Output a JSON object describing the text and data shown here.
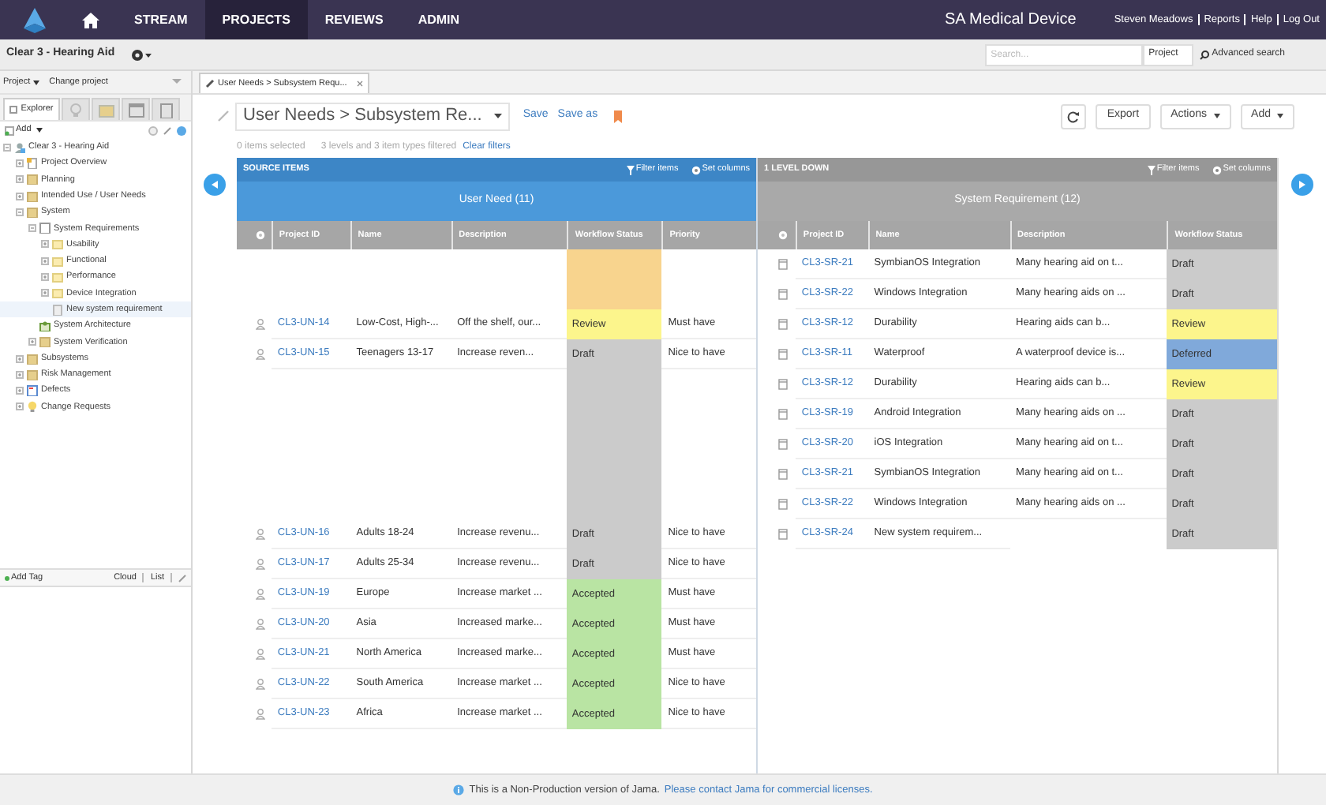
{
  "nav": {
    "items": [
      {
        "label": "STREAM",
        "selected": false
      },
      {
        "label": "PROJECTS",
        "selected": true
      },
      {
        "label": "REVIEWS",
        "selected": false
      },
      {
        "label": "ADMIN",
        "selected": false
      }
    ],
    "org": "SA Medical Device",
    "user_links": [
      "Steven Meadows",
      "Reports",
      "Help",
      "Log Out"
    ]
  },
  "project_bar": {
    "name": "Clear 3 - Hearing Aid",
    "search": {
      "placeholder": "Search..."
    },
    "scope": "Project",
    "advanced": "Advanced search"
  },
  "sidebar": {
    "project_menu": "Project",
    "change": "Change project",
    "tabs": [
      {
        "kind": "explorer",
        "label": "Explorer",
        "selected": true
      },
      {
        "kind": "bulb",
        "selected": false
      },
      {
        "kind": "folder",
        "selected": false
      },
      {
        "kind": "window",
        "selected": false
      },
      {
        "kind": "clipboard",
        "selected": false
      }
    ],
    "add": "Add",
    "tree": [
      {
        "label": "Clear 3 - Hearing Aid",
        "kind": "project",
        "expanded": true,
        "selected": false,
        "children": [
          {
            "label": "Project Overview",
            "kind": "overview",
            "expanded": false,
            "selected": false
          },
          {
            "label": "Planning",
            "kind": "folder",
            "expanded": false,
            "selected": false
          },
          {
            "label": "Intended Use / User Needs",
            "kind": "folder",
            "expanded": false,
            "selected": false
          },
          {
            "label": "System",
            "kind": "folder",
            "expanded": true,
            "selected": false,
            "children": [
              {
                "label": "System Requirements",
                "kind": "set",
                "expanded": true,
                "selected": false,
                "children": [
                  {
                    "label": "Usability",
                    "kind": "subfolder",
                    "expanded": false,
                    "selected": false
                  },
                  {
                    "label": "Functional",
                    "kind": "subfolder",
                    "expanded": false,
                    "selected": false
                  },
                  {
                    "label": "Performance",
                    "kind": "subfolder",
                    "expanded": false,
                    "selected": false
                  },
                  {
                    "label": "Device Integration",
                    "kind": "subfolder",
                    "expanded": false,
                    "selected": false
                  },
                  {
                    "label": "New system requirement",
                    "kind": "item",
                    "selected": true
                  }
                ]
              },
              {
                "label": "System Architecture",
                "kind": "architecture",
                "selected": false
              },
              {
                "label": "System Verification",
                "kind": "folder",
                "expanded": false,
                "selected": false
              }
            ]
          },
          {
            "label": "Subsystems",
            "kind": "folder",
            "expanded": false,
            "selected": false
          },
          {
            "label": "Risk Management",
            "kind": "folder",
            "expanded": false,
            "selected": false
          },
          {
            "label": "Defects",
            "kind": "defects",
            "expanded": false,
            "selected": false
          },
          {
            "label": "Change Requests",
            "kind": "bulb",
            "expanded": false,
            "selected": false
          }
        ]
      }
    ],
    "tag_bar": {
      "add_tag": "Add Tag",
      "cloud": "Cloud",
      "list": "List"
    }
  },
  "tab": {
    "label": "User Needs > Subsystem Requ..."
  },
  "toolbar": {
    "view": "User Needs > Subsystem Re...",
    "save": "Save",
    "save_as": "Save as",
    "export": "Export",
    "actions": "Actions",
    "add": "Add"
  },
  "filter_info": {
    "selected": "0 items selected",
    "filtered": "3 levels and 3 item types filtered",
    "clear": "Clear filters"
  },
  "tables": [
    {
      "section": "SOURCE ITEMS",
      "filter": "Filter items",
      "set_columns": "Set columns",
      "title": "User Need (11)",
      "columns": [
        "Project ID",
        "Name",
        "Description",
        "Workflow Status",
        "Priority"
      ],
      "rows": [
        {
          "kind": "blank",
          "color": "#f8d48e"
        },
        {
          "kind": "blank",
          "color": "#f8d48e"
        },
        {
          "kind": "item",
          "id": "CL3-UN-14",
          "name": "Low-Cost, High-...",
          "description": "Off the shelf, our...",
          "status": "Review",
          "color": "#fcf58c",
          "priority": "Must have"
        },
        {
          "kind": "item",
          "id": "CL3-UN-15",
          "name": "Teenagers 13-17",
          "description": "Increase reven...",
          "status": "Draft",
          "color": "#cbcbcb",
          "priority": "Nice to have"
        },
        {
          "kind": "blank",
          "color": "#cbcbcb"
        },
        {
          "kind": "blank",
          "color": "#cbcbcb"
        },
        {
          "kind": "blank",
          "color": "#cbcbcb"
        },
        {
          "kind": "blank",
          "color": "#cbcbcb"
        },
        {
          "kind": "blank",
          "color": "#cbcbcb"
        },
        {
          "kind": "item",
          "id": "CL3-UN-16",
          "name": "Adults 18-24",
          "description": "Increase revenu...",
          "status": "Draft",
          "color": "#cbcbcb",
          "priority": "Nice to have"
        },
        {
          "kind": "item",
          "id": "CL3-UN-17",
          "name": "Adults 25-34",
          "description": "Increase revenu...",
          "status": "Draft",
          "color": "#cbcbcb",
          "priority": "Nice to have"
        },
        {
          "kind": "item",
          "id": "CL3-UN-19",
          "name": "Europe",
          "description": "Increase market ...",
          "status": "Accepted",
          "color": "#b9e4a3",
          "priority": "Must have"
        },
        {
          "kind": "item",
          "id": "CL3-UN-20",
          "name": "Asia",
          "description": "Increased marke...",
          "status": "Accepted",
          "color": "#b9e4a3",
          "priority": "Must have"
        },
        {
          "kind": "item",
          "id": "CL3-UN-21",
          "name": "North America",
          "description": "Increased marke...",
          "status": "Accepted",
          "color": "#b9e4a3",
          "priority": "Must have"
        },
        {
          "kind": "item",
          "id": "CL3-UN-22",
          "name": "South America",
          "description": "Increase market ...",
          "status": "Accepted",
          "color": "#b9e4a3",
          "priority": "Nice to have"
        },
        {
          "kind": "item",
          "id": "CL3-UN-23",
          "name": "Africa",
          "description": "Increase market ...",
          "status": "Accepted",
          "color": "#b9e4a3",
          "priority": "Nice to have"
        }
      ]
    },
    {
      "section": "1 LEVEL DOWN",
      "filter": "Filter items",
      "set_columns": "Set columns",
      "title": "System Requirement (12)",
      "columns": [
        "Project ID",
        "Name",
        "Description",
        "Workflow Status"
      ],
      "rows": [
        {
          "kind": "item",
          "id": "CL3-SR-21",
          "name": "SymbianOS Integration",
          "description": "Many hearing aid on t...",
          "status": "Draft",
          "color": "#cbcbcb"
        },
        {
          "kind": "item",
          "id": "CL3-SR-22",
          "name": "Windows Integration",
          "description": "Many hearing aids on ...",
          "status": "Draft",
          "color": "#cbcbcb"
        },
        {
          "kind": "item",
          "id": "CL3-SR-12",
          "name": "Durability",
          "description": "Hearing aids can b...",
          "status": "Review",
          "color": "#fcf58c"
        },
        {
          "kind": "item",
          "id": "CL3-SR-11",
          "name": "Waterproof",
          "description": "A waterproof device is...",
          "status": "Deferred",
          "color": "#80a9da"
        },
        {
          "kind": "item",
          "id": "CL3-SR-12",
          "name": "Durability",
          "description": "Hearing aids can b...",
          "status": "Review",
          "color": "#fcf58c"
        },
        {
          "kind": "item",
          "id": "CL3-SR-19",
          "name": "Android Integration",
          "description": "Many hearing aids on ...",
          "status": "Draft",
          "color": "#cbcbcb"
        },
        {
          "kind": "item",
          "id": "CL3-SR-20",
          "name": "iOS Integration",
          "description": "Many hearing aid on t...",
          "status": "Draft",
          "color": "#cbcbcb"
        },
        {
          "kind": "item",
          "id": "CL3-SR-21",
          "name": "SymbianOS Integration",
          "description": "Many hearing aid on t...",
          "status": "Draft",
          "color": "#cbcbcb"
        },
        {
          "kind": "item",
          "id": "CL3-SR-22",
          "name": "Windows Integration",
          "description": "Many hearing aids on ...",
          "status": "Draft",
          "color": "#cbcbcb"
        },
        {
          "kind": "item",
          "id": "CL3-SR-24",
          "name": "New system requirem...",
          "status": "Draft",
          "color": "#cbcbcb"
        }
      ]
    }
  ],
  "footer": {
    "notice": "This is a Non-Production version of Jama.",
    "link": "Please contact Jama for commercial licenses."
  }
}
